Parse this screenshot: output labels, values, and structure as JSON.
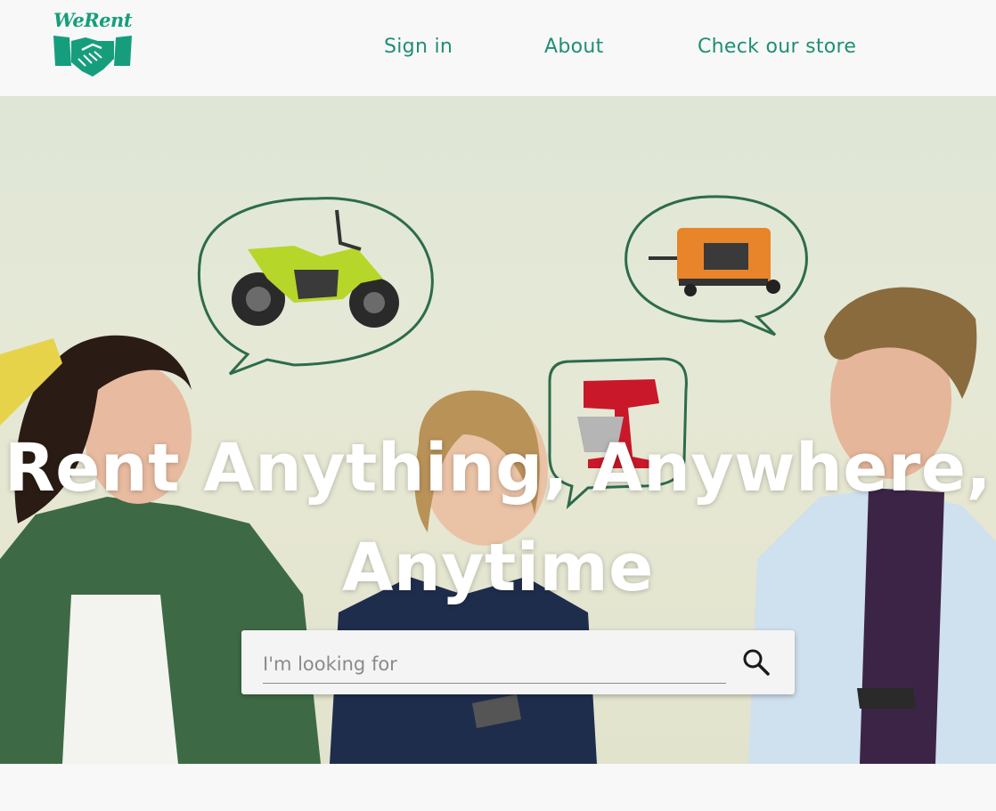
{
  "brand": {
    "name": "WeRent"
  },
  "nav": {
    "items": [
      {
        "label": "Sign in"
      },
      {
        "label": "About"
      },
      {
        "label": "Check our store"
      }
    ]
  },
  "hero": {
    "title_line1": "Rent Anything, Anywhere,",
    "title_line2": "Anytime"
  },
  "search": {
    "placeholder": "I'm looking for",
    "value": ""
  },
  "colors": {
    "brand_green": "#169e7c",
    "nav_text": "#1f8f73",
    "hero_title": "#ffffff"
  },
  "icons": [
    "handshake-icon",
    "search-icon"
  ]
}
